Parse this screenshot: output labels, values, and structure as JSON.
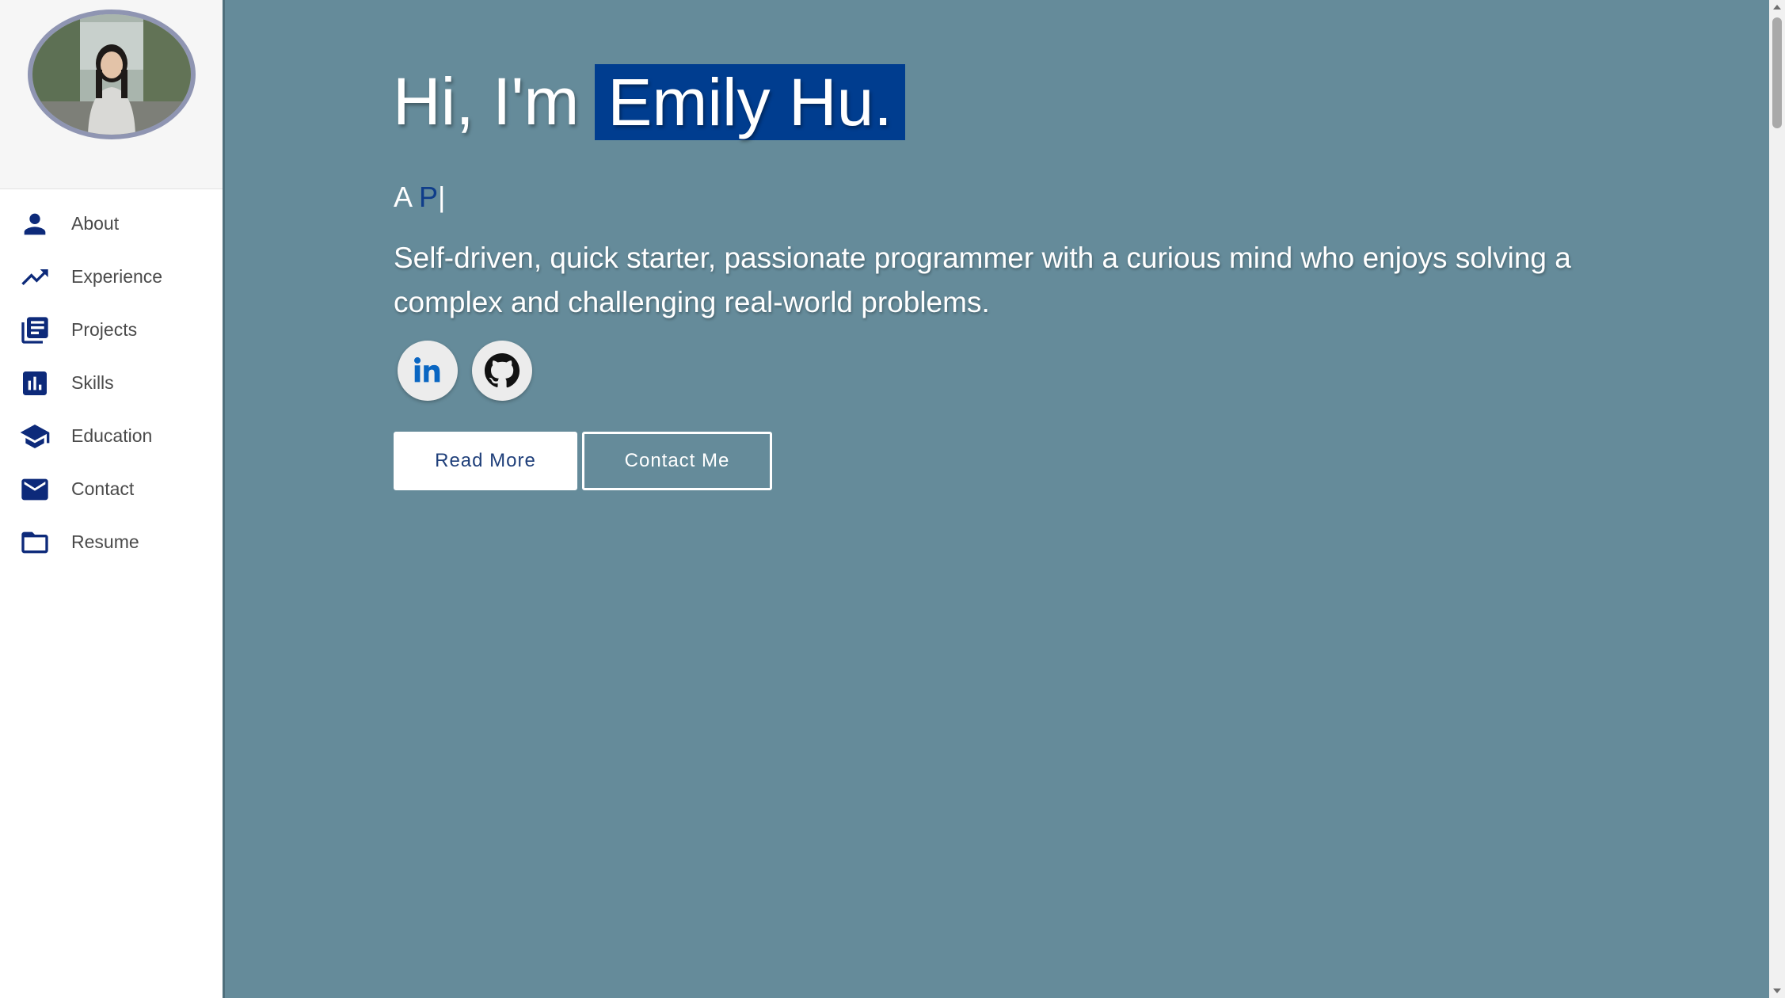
{
  "sidebar": {
    "profile_photo": "profile-photo",
    "items": [
      {
        "label": "About",
        "icon": "person-icon"
      },
      {
        "label": "Experience",
        "icon": "trending-up-icon"
      },
      {
        "label": "Projects",
        "icon": "library-books-icon"
      },
      {
        "label": "Skills",
        "icon": "bar-chart-icon"
      },
      {
        "label": "Education",
        "icon": "school-icon"
      },
      {
        "label": "Contact",
        "icon": "mail-icon"
      },
      {
        "label": "Resume",
        "icon": "folder-icon"
      }
    ]
  },
  "hero": {
    "greeting": "Hi, I'm",
    "name": "Emily Hu.",
    "typed_prefix": "A ",
    "typed_text": "P",
    "typed_cursor": "|",
    "bio": "Self-driven, quick starter, passionate programmer with a curious mind who enjoys solving a complex and challenging real-world problems.",
    "socials": [
      {
        "icon": "linkedin-icon"
      },
      {
        "icon": "github-icon"
      }
    ],
    "read_more_label": "Read More",
    "contact_label": "Contact Me"
  },
  "colors": {
    "background": "#658b9a",
    "accent": "#003d8f",
    "nav_icon": "#0d2a7a"
  }
}
